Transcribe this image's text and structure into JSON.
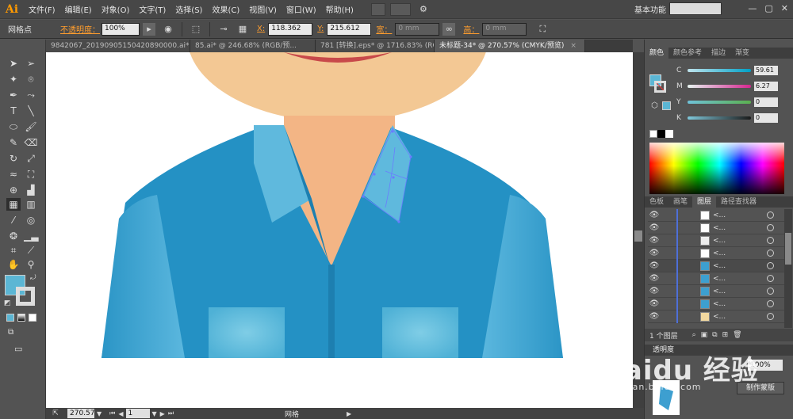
{
  "app": {
    "logo": "Ai",
    "workspace": "基本功能"
  },
  "menu": [
    "文件(F)",
    "编辑(E)",
    "对象(O)",
    "文字(T)",
    "选择(S)",
    "效果(C)",
    "视图(V)",
    "窗口(W)",
    "帮助(H)"
  ],
  "control": {
    "mode_label": "网格点",
    "opacity_label": "不透明度：",
    "opacity_value": "100%",
    "x_label": "X:",
    "x_value": "118.362",
    "y_label": "Y:",
    "y_value": "215.612",
    "w_label": "宽：",
    "w_value": "0 mm",
    "h_label": "高：",
    "h_value": "0 mm"
  },
  "tabs": [
    {
      "label": "9842067_20190905150420890000.ai*",
      "active": false
    },
    {
      "label": "85.ai* @ 246.68% (RGB/预...",
      "active": false
    },
    {
      "label": "781 [转换].eps* @ 1716.83% (RG...",
      "active": false
    },
    {
      "label": "未标题-34* @ 270.57% (CMYK/预览)",
      "active": true
    }
  ],
  "status": {
    "zoom": "270.57",
    "page": "1",
    "tool_name": "网格"
  },
  "color_panel": {
    "tabs": [
      "颜色",
      "颜色参考",
      "描边",
      "渐变"
    ],
    "sliders": [
      {
        "letter": "C",
        "value": "59.61",
        "gradient": "#bfe3ec,#00a0c6"
      },
      {
        "letter": "M",
        "value": "6.27",
        "gradient": "#e6f4f0,#d62690"
      },
      {
        "letter": "Y",
        "value": "0",
        "gradient": "#6fc2d9,#5bb04f"
      },
      {
        "letter": "K",
        "value": "0",
        "gradient": "#7fc7da,#1a1a1a"
      }
    ],
    "fill_color": "#5bb6d4"
  },
  "layers_panel": {
    "tabs": [
      "色板",
      "画笔",
      "图层",
      "路径查找器"
    ],
    "active_tab": "图层",
    "row_label": "<...",
    "footer": "1 个图层"
  },
  "transparency": {
    "tab": "透明度",
    "opacity": "100%",
    "mask_button": "制作蒙版"
  },
  "watermark": {
    "brand": "Baidu 经验",
    "url": "jingyan.baidu.com"
  }
}
